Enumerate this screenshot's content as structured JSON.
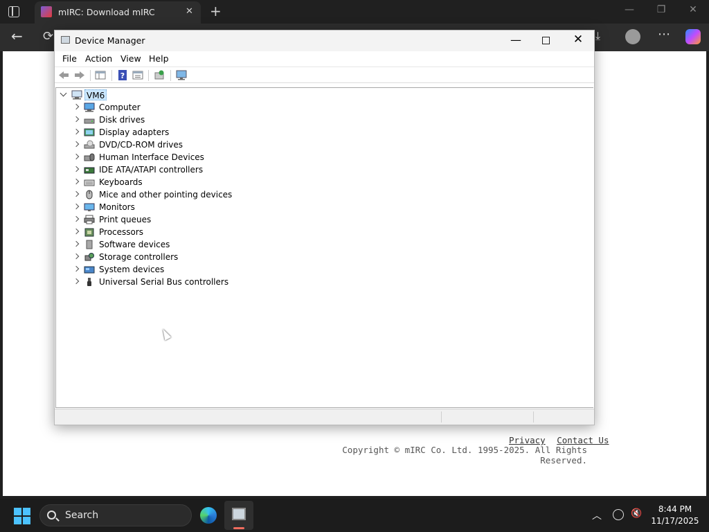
{
  "browser": {
    "tab_title": "mIRC: Download mIRC"
  },
  "web_page": {
    "footer_links": [
      "Privacy",
      "Contact Us"
    ],
    "copyright": "Copyright © mIRC Co. Ltd. 1995-2025. All Rights Reserved."
  },
  "device_manager": {
    "title": "Device Manager",
    "menu": [
      "File",
      "Action",
      "View",
      "Help"
    ],
    "toolbar": [
      "back",
      "forward",
      "show-hide-console-tree",
      "help",
      "properties",
      "update-driver",
      "scan-for-hardware-changes"
    ],
    "tree": {
      "root": "VM6",
      "categories": [
        {
          "label": "Computer",
          "icon": "computer-icon"
        },
        {
          "label": "Disk drives",
          "icon": "disk-drive-icon"
        },
        {
          "label": "Display adapters",
          "icon": "display-adapter-icon"
        },
        {
          "label": "DVD/CD-ROM drives",
          "icon": "dvd-drive-icon"
        },
        {
          "label": "Human Interface Devices",
          "icon": "hid-icon"
        },
        {
          "label": "IDE ATA/ATAPI controllers",
          "icon": "ide-controller-icon"
        },
        {
          "label": "Keyboards",
          "icon": "keyboard-icon"
        },
        {
          "label": "Mice and other pointing devices",
          "icon": "mouse-icon"
        },
        {
          "label": "Monitors",
          "icon": "monitor-icon"
        },
        {
          "label": "Print queues",
          "icon": "printer-icon"
        },
        {
          "label": "Processors",
          "icon": "processor-icon"
        },
        {
          "label": "Software devices",
          "icon": "software-device-icon"
        },
        {
          "label": "Storage controllers",
          "icon": "storage-controller-icon"
        },
        {
          "label": "System devices",
          "icon": "system-devices-icon"
        },
        {
          "label": "Universal Serial Bus controllers",
          "icon": "usb-icon"
        }
      ]
    }
  },
  "taskbar": {
    "search_label": "Search",
    "time": "8:44 PM",
    "date": "11/17/2025"
  },
  "colors": {
    "selection": "#cce8ff",
    "start_accent": "#4cc2ff",
    "taskbar_indicator": "#f06c5e"
  }
}
